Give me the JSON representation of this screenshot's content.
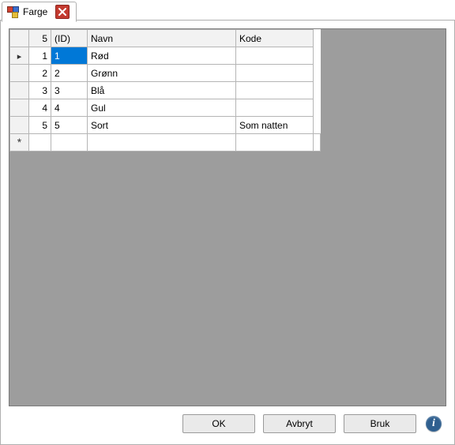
{
  "tab": {
    "title": "Farge"
  },
  "grid": {
    "count_label": "5",
    "columns": {
      "id": "(ID)",
      "navn": "Navn",
      "kode": "Kode"
    },
    "rows": [
      {
        "idx": "1",
        "id": "1",
        "navn": "Rød",
        "kode": "",
        "current": true,
        "id_selected": true
      },
      {
        "idx": "2",
        "id": "2",
        "navn": "Grønn",
        "kode": ""
      },
      {
        "idx": "3",
        "id": "3",
        "navn": "Blå",
        "kode": ""
      },
      {
        "idx": "4",
        "id": "4",
        "navn": "Gul",
        "kode": ""
      },
      {
        "idx": "5",
        "id": "5",
        "navn": "Sort",
        "kode": "Som natten"
      }
    ]
  },
  "buttons": {
    "ok": "OK",
    "cancel": "Avbryt",
    "apply": "Bruk"
  }
}
